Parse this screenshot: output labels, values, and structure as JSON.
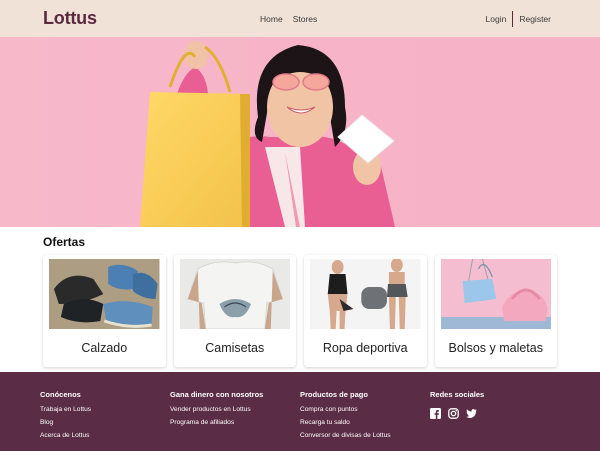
{
  "nav": {
    "brand": "Lottus",
    "links": [
      "Home",
      "Stores"
    ],
    "login": "Login",
    "register": "Register"
  },
  "colors": {
    "nav_bg": "#f1e2d7",
    "brand": "#5a2a3f",
    "hero_bg": "#f7b4c8",
    "footer_bg": "#5b2c45"
  },
  "offers": {
    "title": "Ofertas",
    "cards": [
      {
        "label": "Calzado",
        "image": "shoes-photo"
      },
      {
        "label": "Camisetas",
        "image": "tshirt-photo"
      },
      {
        "label": "Ropa deportiva",
        "image": "sportswear-photo"
      },
      {
        "label": "Bolsos y maletas",
        "image": "bags-photo"
      }
    ]
  },
  "footer": {
    "columns": [
      {
        "title": "Conócenos",
        "links": [
          "Trabaja en Lottus",
          "Blog",
          "Acerca de Lottus"
        ]
      },
      {
        "title": "Gana dinero con nosotros",
        "links": [
          "Vender productos en Lottus",
          "Programa de afiliados"
        ]
      },
      {
        "title": "Productos de pago",
        "links": [
          "Compra con puntos",
          "Recarga tu saldo",
          "Conversor de divisas de Lottus"
        ]
      },
      {
        "title": "Redes sociales",
        "icons": [
          "facebook-icon",
          "instagram-icon",
          "twitter-icon"
        ]
      }
    ]
  }
}
